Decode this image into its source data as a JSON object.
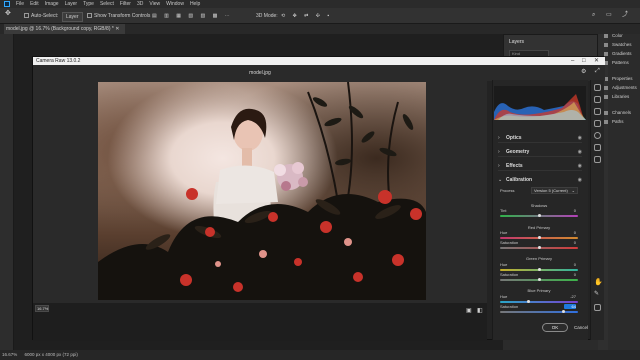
{
  "menubar": {
    "items": [
      "File",
      "Edit",
      "Image",
      "Layer",
      "Type",
      "Select",
      "Filter",
      "3D",
      "View",
      "Window",
      "Help"
    ]
  },
  "optionsbar": {
    "auto_select_label": "Auto-Select:",
    "auto_select_value": "Layer",
    "show_transform_label": "Show Transform Controls",
    "mode_3d_label": "3D Mode:"
  },
  "document": {
    "tab_title": "model.jpg @ 16.7% (Background copy, RGB/8) *"
  },
  "layers_panel": {
    "title": "Layers",
    "kind_placeholder": "Kind"
  },
  "right_panels": [
    "Color",
    "Swatches",
    "Gradients",
    "Patterns",
    "Properties",
    "Adjustments",
    "Libraries",
    "Channels",
    "Paths"
  ],
  "statusbar": {
    "zoom": "16.67%",
    "doc_size": "6000 px x 4000 px (72 ppi)"
  },
  "camera_raw": {
    "title": "Camera Raw 13.0.2",
    "filename": "model.jpg",
    "zoom_value": "16.7%",
    "sections": [
      {
        "label": "Optics",
        "expanded": false
      },
      {
        "label": "Geometry",
        "expanded": false
      },
      {
        "label": "Effects",
        "expanded": false
      },
      {
        "label": "Calibration",
        "expanded": true
      }
    ],
    "calibration": {
      "process_label": "Process",
      "process_value": "Version 5 (Current)",
      "shadows_heading": "Shadows",
      "red_primary_heading": "Red Primary",
      "green_primary_heading": "Green Primary",
      "blue_primary_heading": "Blue Primary",
      "rows": [
        {
          "label": "Tint",
          "value": "0",
          "fraction": 0.5,
          "gradient": "linear-gradient(90deg,#2fb34a,#b43fb8)"
        },
        {
          "label": "Hue",
          "value": "0",
          "fraction": 0.5,
          "gradient": "linear-gradient(90deg,#c2366e,#d28a2e)"
        },
        {
          "label": "Saturation",
          "value": "0",
          "fraction": 0.5,
          "gradient": "linear-gradient(90deg,#777,#d23c3c)"
        },
        {
          "label": "Hue",
          "value": "0",
          "fraction": 0.5,
          "gradient": "linear-gradient(90deg,#c7b02a,#2fb3a0)"
        },
        {
          "label": "Saturation",
          "value": "0",
          "fraction": 0.5,
          "gradient": "linear-gradient(90deg,#777,#3cb34a)"
        },
        {
          "label": "Hue",
          "value": "-27",
          "fraction": 0.36,
          "gradient": "linear-gradient(90deg,#2aa6c7,#7a3fd0)"
        },
        {
          "label": "Saturation",
          "value": "64",
          "fraction": 0.82,
          "gradient": "linear-gradient(90deg,#777,#2f6fe0)"
        }
      ]
    },
    "buttons": {
      "ok": "OK",
      "cancel": "Cancel"
    }
  },
  "colors": {
    "accent": "#1e7ae0",
    "ps_blue": "#31a8ff"
  }
}
